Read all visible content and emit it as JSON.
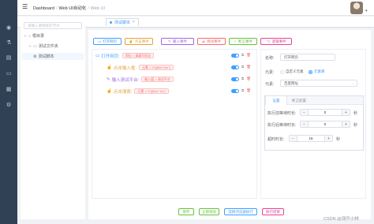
{
  "header": {
    "breadcrumb": [
      "Dashboard",
      "Web UI自动化",
      "Web UI"
    ],
    "separator": "/"
  },
  "tabs": [
    {
      "label": "测试脚本",
      "close": "×"
    }
  ],
  "tree": {
    "search_placeholder": "请输入要搜索的节点",
    "nodes": [
      {
        "label": "根目录"
      },
      {
        "label": "测试文件夹"
      },
      {
        "label": "测试脚本"
      }
    ]
  },
  "toolbar": [
    {
      "label": "打开网页",
      "color": "#409eff",
      "icon": "window-icon"
    },
    {
      "label": "点击事件",
      "color": "#e6a23c",
      "icon": "pointer-icon"
    },
    {
      "label": "输入事件",
      "color": "#9c6ade",
      "icon": "edit-icon"
    },
    {
      "label": "滑动事件",
      "color": "#f56c6c",
      "icon": "swipe-icon"
    },
    {
      "label": "断言事件",
      "color": "#67c23a",
      "icon": "check-icon"
    },
    {
      "label": "逻辑事件",
      "color": "#e84393",
      "icon": "logic-icon"
    }
  ],
  "steps": [
    {
      "label": "打开网页:",
      "tag": "网址 = 请填写网址",
      "color": "#409eff",
      "icon": "window-icon",
      "enabled": true
    },
    {
      "label": "点击输入框:",
      "tag": "元素 = //*[@id=\"kw\"]",
      "color": "#e6a23c",
      "icon": "pointer-icon",
      "enabled": true
    },
    {
      "label": "输入测试平台:",
      "tag": "输入值 = 测试平台",
      "color": "#9c6ade",
      "icon": "edit-icon",
      "enabled": true
    },
    {
      "label": "点击搜索:",
      "tag": "元素 = //*[@id=\"su\"]",
      "color": "#e6a23c",
      "icon": "pointer-icon",
      "enabled": true
    }
  ],
  "properties": {
    "name_label": "名称:",
    "name_value": "打开网页",
    "element_label": "元素:",
    "radio_custom": "自定义元素",
    "radio_library": "元素库",
    "radio_selected": "元素库",
    "element_select": "百度网址",
    "tabs": [
      "设置",
      "断言配置"
    ],
    "active_tab": "设置",
    "pre_wait_label": "执行前等待时长:",
    "pre_wait_value": "0",
    "post_wait_label": "执行后等待时长:",
    "post_wait_value": "0",
    "timeout_label": "超时时长:",
    "timeout_value": "15",
    "unit": "秒",
    "minus": "−",
    "plus": "+"
  },
  "bottom_buttons": [
    {
      "label": "保存",
      "color": "#67c23a"
    },
    {
      "label": "立即调试",
      "color": "#67c23a"
    },
    {
      "label": "选择浏览器执行",
      "color": "#409eff"
    },
    {
      "label": "执行结果",
      "color": "#e84393"
    }
  ],
  "watermark": "CSDN @测开小林"
}
